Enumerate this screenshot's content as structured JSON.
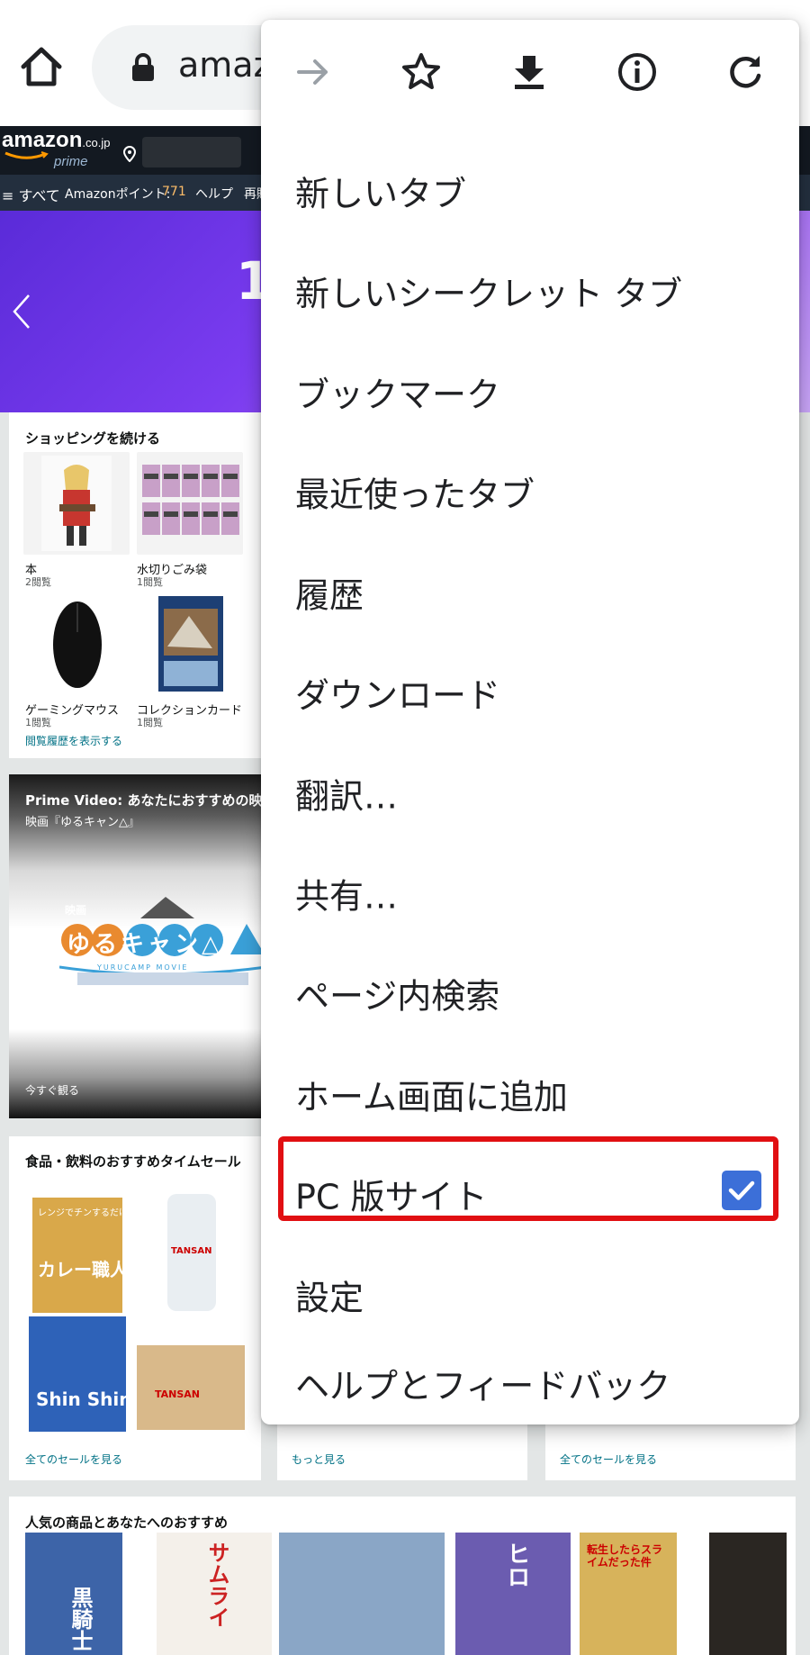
{
  "browser": {
    "url": "amaz",
    "icons": [
      "home-icon",
      "lock-icon"
    ]
  },
  "amazon": {
    "logo": "amazon",
    "logo_domain": ".co.jp",
    "logo_prime": "prime",
    "nav": {
      "menu_label": "≡ すべて",
      "points_label": "Amazonポイント:",
      "points_value": "771",
      "help": "ヘルプ",
      "more": "再購"
    },
    "hero_text": "1",
    "continue_shopping": {
      "title": "ショッピングを続ける",
      "items": [
        {
          "label": "本",
          "sub": "2閲覧"
        },
        {
          "label": "水切りごみ袋",
          "sub": "1閲覧"
        },
        {
          "label": "ゲーミングマウス",
          "sub": "1閲覧"
        },
        {
          "label": "コレクションカード",
          "sub": "1閲覧"
        }
      ],
      "link": "閲覧履歴を表示する"
    },
    "prime_video": {
      "title": "Prime Video: あなたにおすすめの映画",
      "subtitle": "映画『ゆるキャン△』",
      "logo_small": "映画",
      "logo_text": "ゆるキャン△",
      "logo_caption": "YURUCAMP MOVIE",
      "watch": "今すぐ観る"
    },
    "food_sale": {
      "title": "食品・飲料のおすすめタイムセール",
      "link": "全てのセールを見る",
      "products": {
        "curry": "カレー職人",
        "curry_top": "レンジでチンするだけ!",
        "tansan": "TANSAN",
        "ramen": "Shin Shin",
        "box_brand": "TANSAN"
      }
    },
    "more_link": "もっと見る",
    "sale_link2": "全てのセールを見る",
    "recommend_title": "人気の商品とあなたへのおすすめ",
    "book_texts": [
      "黒騎士",
      "サムライ",
      "ヒロ",
      "転生したらスライムだった件"
    ]
  },
  "menu": {
    "toolbar": [
      "forward-icon",
      "bookmark-star-icon",
      "download-icon",
      "info-icon",
      "reload-icon"
    ],
    "items": [
      {
        "label": "新しいタブ"
      },
      {
        "label": "新しいシークレット タブ"
      },
      {
        "label": "ブックマーク"
      },
      {
        "label": "最近使ったタブ"
      },
      {
        "label": "履歴"
      },
      {
        "label": "ダウンロード"
      },
      {
        "label": "翻訳…"
      },
      {
        "label": "共有…"
      },
      {
        "label": "ページ内検索"
      },
      {
        "label": "ホーム画面に追加"
      },
      {
        "label": "PC 版サイト",
        "checked": true
      },
      {
        "label": "設定"
      },
      {
        "label": "ヘルプとフィードバック"
      }
    ],
    "highlight_color": "#e10f12",
    "checkbox_color": "#3c6fd8"
  }
}
